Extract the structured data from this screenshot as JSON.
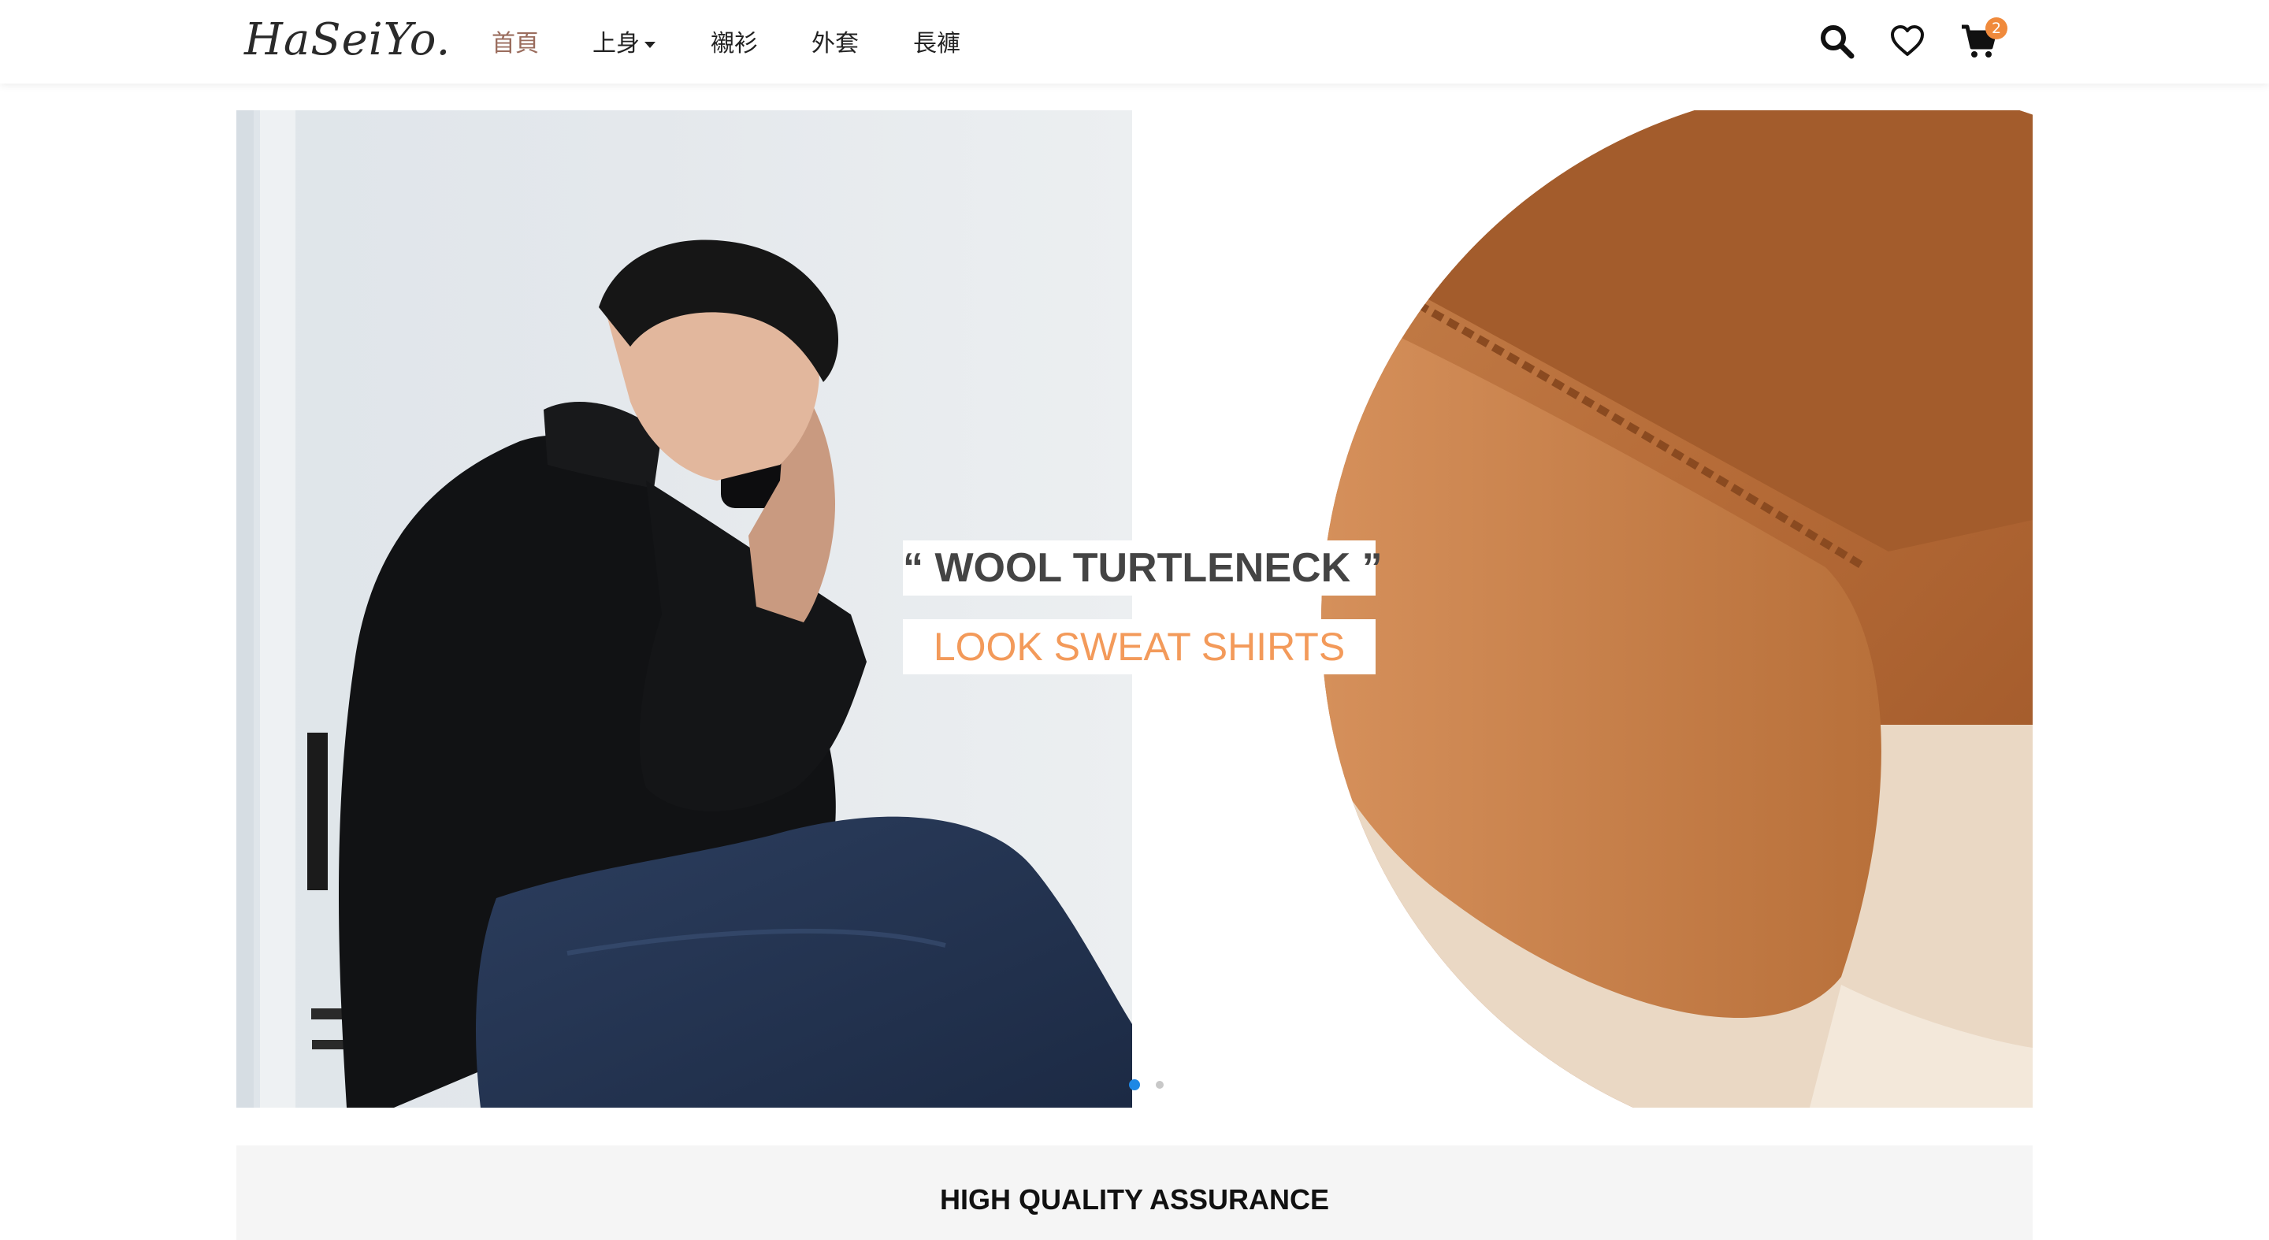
{
  "brand": {
    "logo_text": "HaSeiYo."
  },
  "nav": {
    "items": [
      {
        "label": "首頁",
        "active": true
      },
      {
        "label": "上身",
        "has_dropdown": true
      },
      {
        "label": "襯衫"
      },
      {
        "label": "外套"
      },
      {
        "label": "長褲"
      }
    ]
  },
  "header_icons": {
    "search": "search-icon",
    "wishlist": "heart-icon",
    "cart": "cart-icon",
    "cart_count": "2"
  },
  "hero": {
    "caption_title": "“ WOOL TURTLENECK ”",
    "caption_subtitle": "LOOK SWEAT SHIRTS",
    "slide_count": 2,
    "active_slide": 1
  },
  "assurance": {
    "title": "HIGH QUALITY ASSURANCE"
  },
  "colors": {
    "nav_active": "#9a6c5d",
    "accent_orange": "#f39a5a",
    "badge": "#f08a3c",
    "dot_active": "#1e88e5"
  }
}
